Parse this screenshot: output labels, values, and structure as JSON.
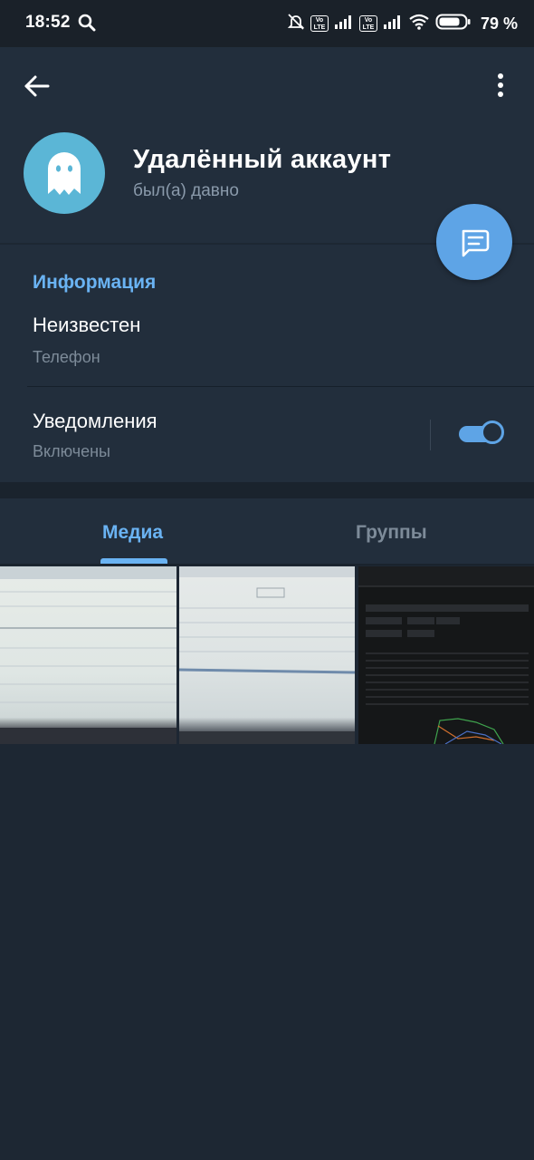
{
  "status_bar": {
    "time": "18:52",
    "battery_percent": "79 %",
    "icons": [
      "search-icon",
      "silent-alarm-icon",
      "volte-icon",
      "signal-icon",
      "volte-icon",
      "signal-icon",
      "wifi-icon",
      "battery-icon"
    ]
  },
  "profile": {
    "name": "Удалённый аккаунт",
    "last_seen": "был(а) давно",
    "avatar_icon": "ghost-icon"
  },
  "info": {
    "title": "Информация",
    "phone_value": "Неизвестен",
    "phone_label": "Телефон",
    "notifications_title": "Уведомления",
    "notifications_state": "Включены",
    "notifications_enabled": true
  },
  "tabs": [
    {
      "label": "Медиа",
      "active": true
    },
    {
      "label": "Группы",
      "active": false
    }
  ],
  "media": {
    "thumbnails": [
      "photo-of-screen-1",
      "photo-of-screen-2",
      "screenshot-dark-dashboard"
    ]
  },
  "colors": {
    "accent": "#6ab3f3",
    "fab": "#5ea4e6",
    "avatar": "#5bb6d6",
    "header_bg": "#222e3c",
    "page_bg": "#1d2733"
  }
}
